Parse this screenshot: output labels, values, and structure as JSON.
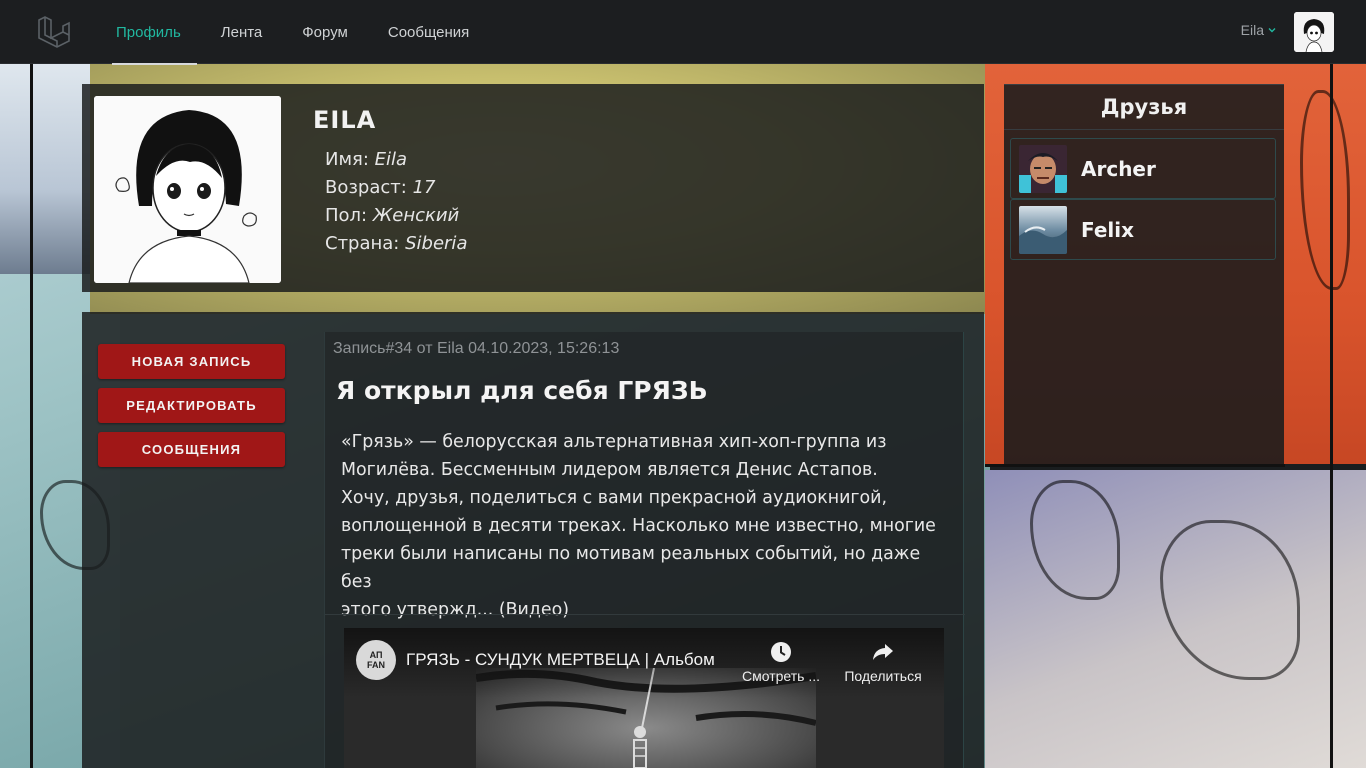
{
  "nav": {
    "logo_icon": "laravel-logo-icon",
    "links": [
      {
        "label": "Профиль",
        "active": true
      },
      {
        "label": "Лента",
        "active": false
      },
      {
        "label": "Форум",
        "active": false
      },
      {
        "label": "Сообщения",
        "active": false
      }
    ],
    "user_name": "Eila",
    "accent_color": "#21b8a0"
  },
  "profile": {
    "name": "EILA",
    "fields": [
      {
        "label": "Имя:",
        "value": "Eila"
      },
      {
        "label": "Возраст:",
        "value": "17"
      },
      {
        "label": "Пол:",
        "value": "Женский"
      },
      {
        "label": "Страна:",
        "value": "Siberia"
      }
    ]
  },
  "friends": {
    "title": "Друзья",
    "items": [
      {
        "name": "Archer"
      },
      {
        "name": "Felix"
      }
    ]
  },
  "actions": {
    "new_post": "НОВАЯ ЗАПИСЬ",
    "edit": "РЕДАКТИРОВАТЬ",
    "messages": "СООБЩЕНИЯ",
    "button_color": "#a01717"
  },
  "post": {
    "meta": "Запись#34 от Eila 04.10.2023, 15:26:13",
    "title": "Я открыл для себя ГРЯЗЬ",
    "body_lines": [
      "«Грязь» — белорусская альтернативная хип-хоп-группа из",
      "Могилёва. Бессменным лидером является Денис Астапов.",
      "Хочу, друзья, поделиться с вами прекрасной аудиокнигой,",
      "воплощенной в десяти треках. Насколько мне известно, многие",
      "треки были написаны по мотивам реальных событий, но даже без",
      "этого утвержд... (Видео)"
    ]
  },
  "video": {
    "channel_logo_text": "АП FAN",
    "title": "ГРЯЗЬ - СУНДУК МЕРТВЕЦА | Альбом",
    "watch_later": "Смотреть ...",
    "share": "Поделиться"
  }
}
